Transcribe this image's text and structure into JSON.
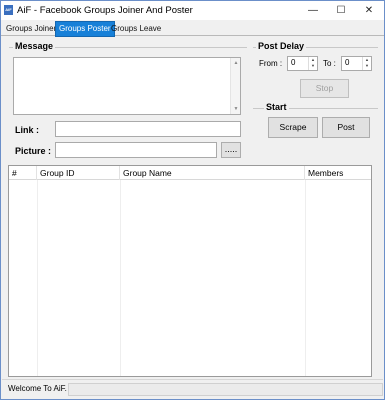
{
  "window": {
    "icon_text": "AiF",
    "title": "AiF - Facebook Groups Joiner And Poster",
    "minimize": "—",
    "maximize": "☐",
    "close": "✕"
  },
  "tabs": [
    {
      "label": "Groups Joiner",
      "selected": false
    },
    {
      "label": "Groups Poster",
      "selected": true
    },
    {
      "label": "Groups Leave",
      "selected": false
    }
  ],
  "message": {
    "group_title": "Message",
    "text": ""
  },
  "link": {
    "label": "Link :",
    "value": ""
  },
  "picture": {
    "label": "Picture :",
    "value": "",
    "browse_label": "....."
  },
  "post_delay": {
    "group_title": "Post Delay",
    "from_label": "From :",
    "from_value": "0",
    "to_label": "To :",
    "to_value": "0",
    "stop_label": "Stop"
  },
  "start": {
    "group_title": "Start",
    "scrape_label": "Scrape",
    "post_label": "Post"
  },
  "table": {
    "columns": [
      "#",
      "Group ID",
      "Group Name",
      "Members"
    ],
    "rows": []
  },
  "status": {
    "text": "Welcome To AiF.",
    "progress": 0
  },
  "colors": {
    "selected_tab": "#1780d8",
    "window_border": "#6b8fc9",
    "progress_fill": "#06b025"
  }
}
